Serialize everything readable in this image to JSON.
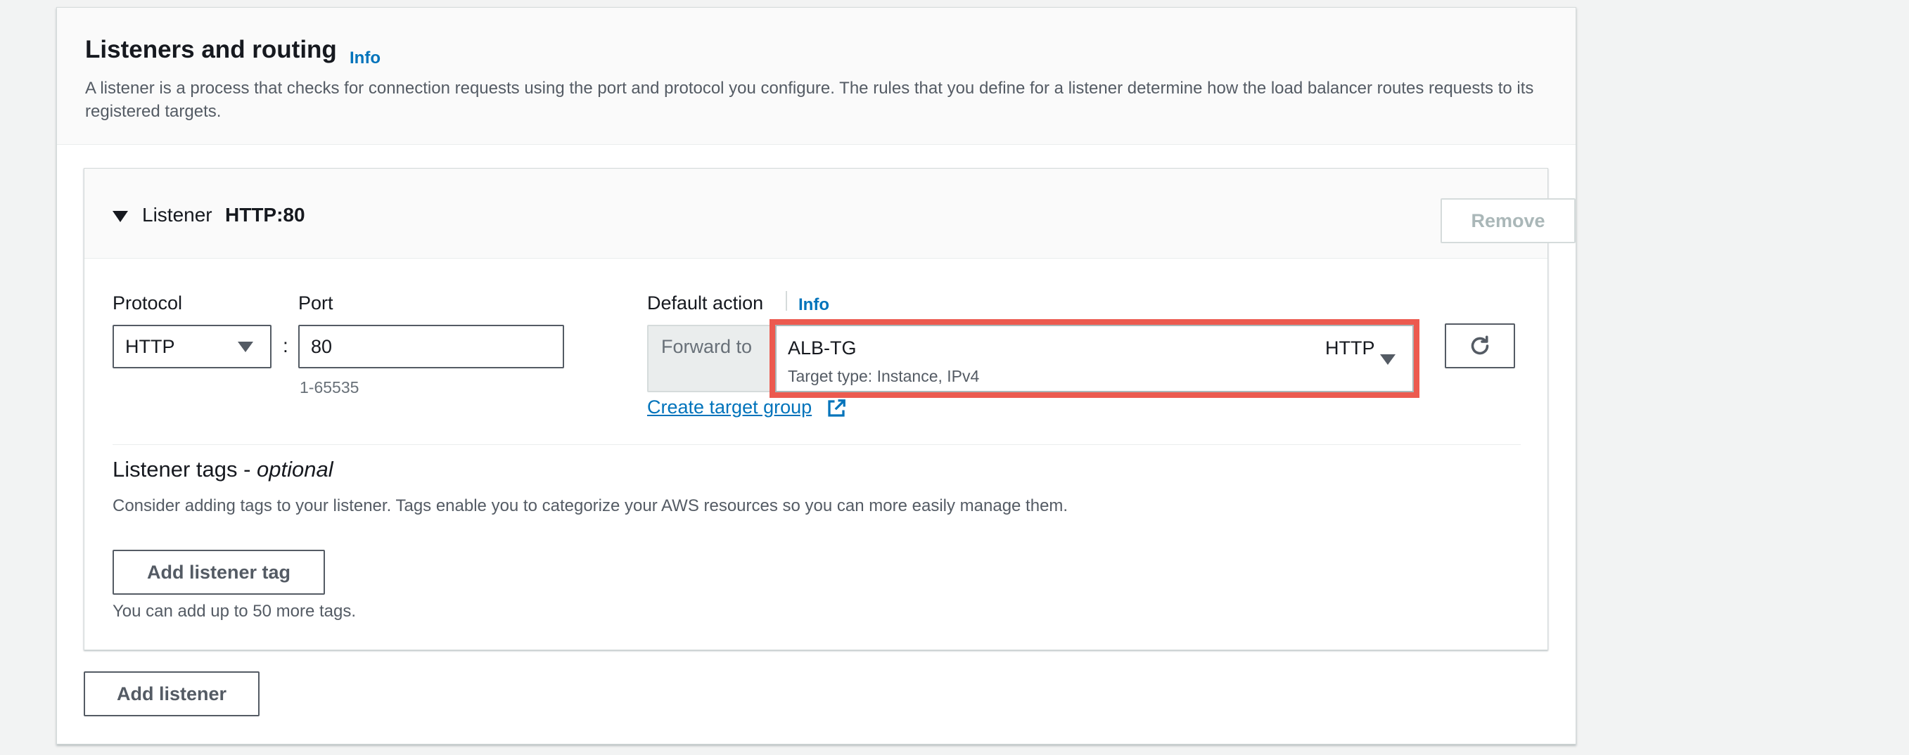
{
  "section": {
    "title": "Listeners and routing",
    "info_label": "Info",
    "description": "A listener is a process that checks for connection requests using the port and protocol you configure. The rules that you define for a listener determine how the load balancer routes requests to its registered targets."
  },
  "listener": {
    "heading_label": "Listener",
    "heading_value": "HTTP:80",
    "remove_label": "Remove",
    "protocol": {
      "label": "Protocol",
      "value": "HTTP"
    },
    "separator": ":",
    "port": {
      "label": "Port",
      "value": "80",
      "hint": "1-65535"
    },
    "default_action": {
      "label": "Default action",
      "info_label": "Info",
      "forward_label": "Forward to",
      "target_group_name": "ALB-TG",
      "target_group_protocol": "HTTP",
      "target_group_type": "Target type: Instance, IPv4",
      "create_link_label": "Create target group"
    },
    "tags": {
      "title": "Listener tags - ",
      "title_optional": "optional",
      "description": "Consider adding tags to your listener. Tags enable you to categorize your AWS resources so you can more easily manage them.",
      "add_tag_label": "Add listener tag",
      "limit_text": "You can add up to 50 more tags."
    }
  },
  "add_listener_label": "Add listener",
  "colors": {
    "link": "#0073bb",
    "highlight": "#ec5a4f",
    "text": "#16191f",
    "secondary_text": "#545b64"
  },
  "icons": [
    "caret-down-icon",
    "dropdown-triangle-icon",
    "refresh-icon",
    "external-link-icon"
  ]
}
